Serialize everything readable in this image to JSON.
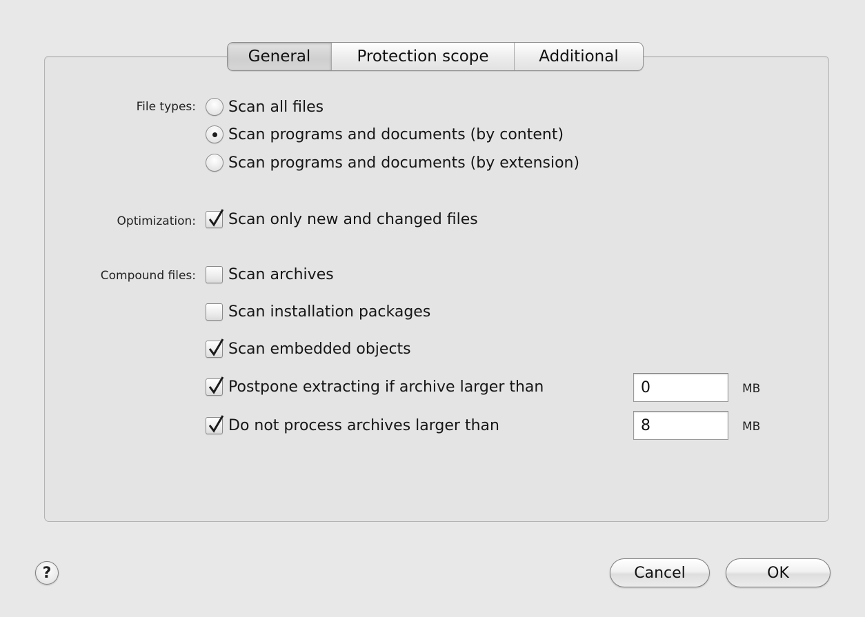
{
  "tabs": {
    "general": "General",
    "protection_scope": "Protection scope",
    "additional": "Additional"
  },
  "file_types": {
    "label": "File types:",
    "options": [
      {
        "label": "Scan all files",
        "selected": false
      },
      {
        "label": "Scan programs and documents (by content)",
        "selected": true
      },
      {
        "label": "Scan programs and documents (by extension)",
        "selected": false
      }
    ]
  },
  "optimization": {
    "label": "Optimization:",
    "option": {
      "label": "Scan only new and changed files",
      "checked": true
    }
  },
  "compound_files": {
    "label": "Compound files:",
    "options": [
      {
        "label": "Scan archives",
        "checked": false
      },
      {
        "label": "Scan installation packages",
        "checked": false
      },
      {
        "label": "Scan embedded objects",
        "checked": true
      },
      {
        "label": "Postpone extracting if archive larger than",
        "checked": true,
        "value": "0",
        "unit": "MB"
      },
      {
        "label": "Do not process archives larger than",
        "checked": true,
        "value": "8",
        "unit": "MB"
      }
    ]
  },
  "buttons": {
    "help": "?",
    "cancel": "Cancel",
    "ok": "OK"
  }
}
